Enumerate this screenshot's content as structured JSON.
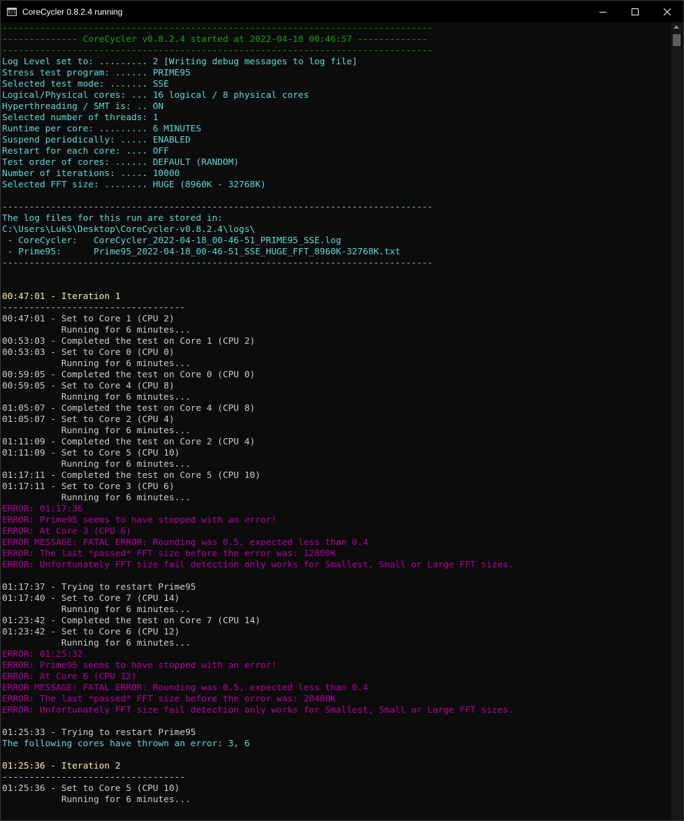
{
  "window": {
    "title": "CoreCycler 0.8.2.4 running",
    "icon_name": "console-app-icon",
    "icon_glyph": "C:\\",
    "controls": [
      "minimize-icon",
      "maximize-icon",
      "close-icon"
    ]
  },
  "colors": {
    "background": "#0c0c0c",
    "green": "#13a10e",
    "gray": "#cccccc",
    "cyan": "#61d6d6",
    "yellow": "#f9f1a5",
    "magenta": "#b4009e"
  },
  "console": {
    "lines": [
      {
        "c": "green",
        "t": "--------------------------------------------------------------------------------"
      },
      {
        "c": "green",
        "t": "-------------- CoreCycler v0.8.2.4 started at 2022-04-18 00:46:57 -------------"
      },
      {
        "c": "green",
        "t": "--------------------------------------------------------------------------------"
      },
      {
        "c": "cyan",
        "t": "Log Level set to: ......... 2 [Writing debug messages to log file]"
      },
      {
        "c": "cyan",
        "t": "Stress test program: ...... PRIME95"
      },
      {
        "c": "cyan",
        "t": "Selected test mode: ....... SSE"
      },
      {
        "c": "cyan",
        "t": "Logical/Physical cores: ... 16 logical / 8 physical cores"
      },
      {
        "c": "cyan",
        "t": "Hyperthreading / SMT is: .. ON"
      },
      {
        "c": "cyan",
        "t": "Selected number of threads: 1"
      },
      {
        "c": "cyan",
        "t": "Runtime per core: ......... 6 MINUTES"
      },
      {
        "c": "cyan",
        "t": "Suspend periodically: ..... ENABLED"
      },
      {
        "c": "cyan",
        "t": "Restart for each core: .... OFF"
      },
      {
        "c": "cyan",
        "t": "Test order of cores: ...... DEFAULT (RANDOM)"
      },
      {
        "c": "cyan",
        "t": "Number of iterations: ..... 10000"
      },
      {
        "c": "cyan",
        "t": "Selected FFT size: ........ HUGE (8960K - 32768K)"
      },
      {
        "c": "cyan",
        "t": ""
      },
      {
        "c": "cyan",
        "t": "--------------------------------------------------------------------------------"
      },
      {
        "c": "cyan",
        "t": "The log files for this run are stored in:"
      },
      {
        "c": "cyan",
        "t": "C:\\Users\\LukS\\Desktop\\CoreCycler-v0.8.2.4\\logs\\"
      },
      {
        "c": "cyan",
        "t": " - CoreCycler:   CoreCycler_2022-04-18_00-46-51_PRIME95_SSE.log"
      },
      {
        "c": "cyan",
        "t": " - Prime95:      Prime95_2022-04-18_00-46-51_SSE_HUGE_FFT_8960K-32768K.txt"
      },
      {
        "c": "cyan",
        "t": "--------------------------------------------------------------------------------"
      },
      {
        "c": "gray",
        "t": ""
      },
      {
        "c": "gray",
        "t": ""
      },
      {
        "c": "yellow",
        "t": "00:47:01 - Iteration 1"
      },
      {
        "c": "gray",
        "t": "----------------------------------"
      },
      {
        "c": "gray",
        "t": "00:47:01 - Set to Core 1 (CPU 2)"
      },
      {
        "c": "gray",
        "t": "           Running for 6 minutes..."
      },
      {
        "c": "gray",
        "t": "00:53:03 - Completed the test on Core 1 (CPU 2)"
      },
      {
        "c": "gray",
        "t": "00:53:03 - Set to Core 0 (CPU 0)"
      },
      {
        "c": "gray",
        "t": "           Running for 6 minutes..."
      },
      {
        "c": "gray",
        "t": "00:59:05 - Completed the test on Core 0 (CPU 0)"
      },
      {
        "c": "gray",
        "t": "00:59:05 - Set to Core 4 (CPU 8)"
      },
      {
        "c": "gray",
        "t": "           Running for 6 minutes..."
      },
      {
        "c": "gray",
        "t": "01:05:07 - Completed the test on Core 4 (CPU 8)"
      },
      {
        "c": "gray",
        "t": "01:05:07 - Set to Core 2 (CPU 4)"
      },
      {
        "c": "gray",
        "t": "           Running for 6 minutes..."
      },
      {
        "c": "gray",
        "t": "01:11:09 - Completed the test on Core 2 (CPU 4)"
      },
      {
        "c": "gray",
        "t": "01:11:09 - Set to Core 5 (CPU 10)"
      },
      {
        "c": "gray",
        "t": "           Running for 6 minutes..."
      },
      {
        "c": "gray",
        "t": "01:17:11 - Completed the test on Core 5 (CPU 10)"
      },
      {
        "c": "gray",
        "t": "01:17:11 - Set to Core 3 (CPU 6)"
      },
      {
        "c": "gray",
        "t": "           Running for 6 minutes..."
      },
      {
        "c": "magenta",
        "t": "ERROR: 01:17:36"
      },
      {
        "c": "magenta",
        "t": "ERROR: Prime95 seems to have stopped with an error!"
      },
      {
        "c": "magenta",
        "t": "ERROR: At Core 3 (CPU 6)"
      },
      {
        "c": "magenta",
        "t": "ERROR MESSAGE: FATAL ERROR: Rounding was 0.5, expected less than 0.4"
      },
      {
        "c": "magenta",
        "t": "ERROR: The last *passed* FFT size before the error was: 12800K"
      },
      {
        "c": "magenta",
        "t": "ERROR: Unfortunately FFT size fail detection only works for Smallest, Small or Large FFT sizes."
      },
      {
        "c": "gray",
        "t": ""
      },
      {
        "c": "gray",
        "t": "01:17:37 - Trying to restart Prime95"
      },
      {
        "c": "gray",
        "t": "01:17:40 - Set to Core 7 (CPU 14)"
      },
      {
        "c": "gray",
        "t": "           Running for 6 minutes..."
      },
      {
        "c": "gray",
        "t": "01:23:42 - Completed the test on Core 7 (CPU 14)"
      },
      {
        "c": "gray",
        "t": "01:23:42 - Set to Core 6 (CPU 12)"
      },
      {
        "c": "gray",
        "t": "           Running for 6 minutes..."
      },
      {
        "c": "magenta",
        "t": "ERROR: 01:25:32"
      },
      {
        "c": "magenta",
        "t": "ERROR: Prime95 seems to have stopped with an error!"
      },
      {
        "c": "magenta",
        "t": "ERROR: At Core 6 (CPU 12)"
      },
      {
        "c": "magenta",
        "t": "ERROR MESSAGE: FATAL ERROR: Rounding was 0.5, expected less than 0.4"
      },
      {
        "c": "magenta",
        "t": "ERROR: The last *passed* FFT size before the error was: 20480K"
      },
      {
        "c": "magenta",
        "t": "ERROR: Unfortunately FFT size fail detection only works for Smallest, Small or Large FFT sizes."
      },
      {
        "c": "gray",
        "t": ""
      },
      {
        "c": "gray",
        "t": "01:25:33 - Trying to restart Prime95"
      },
      {
        "c": "cyan",
        "t": "The following cores have thrown an error: 3, 6"
      },
      {
        "c": "gray",
        "t": ""
      },
      {
        "c": "yellow",
        "t": "01:25:36 - Iteration 2"
      },
      {
        "c": "gray",
        "t": "----------------------------------"
      },
      {
        "c": "gray",
        "t": "01:25:36 - Set to Core 5 (CPU 10)"
      },
      {
        "c": "gray",
        "t": "           Running for 6 minutes..."
      }
    ]
  }
}
